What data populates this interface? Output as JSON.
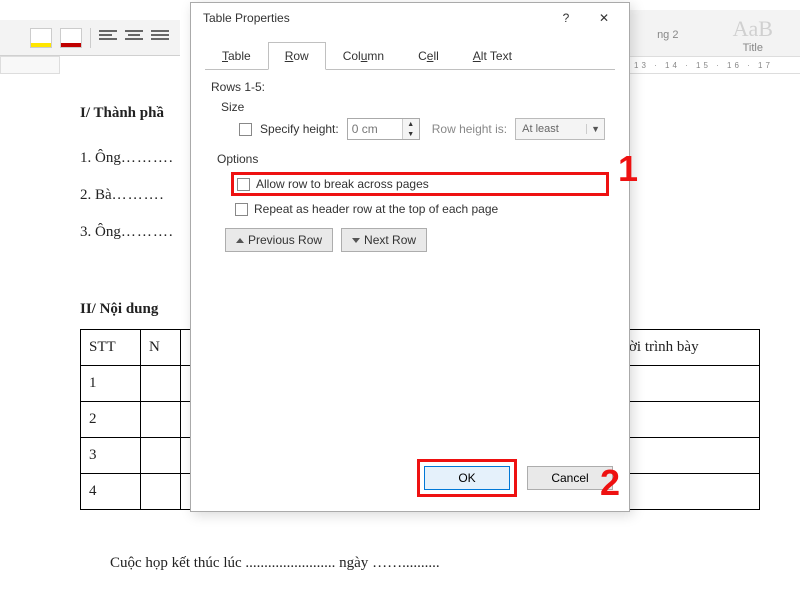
{
  "ribbon": {
    "style1": "ng 2",
    "style2": "Title",
    "ruler_right": "13 · 14 · 15 · 16 · 17"
  },
  "document": {
    "heading1": "I/ Thành phầ",
    "line1_prefix": "1. Ông",
    "line2_prefix": "2. Bà",
    "line3_prefix": "3. Ông",
    "dots_short": "……….",
    "heading2": "II/ Nội dung",
    "table": {
      "headers": {
        "c1": "STT",
        "c2": "N",
        "c_last": "ời trình bày"
      },
      "rows": [
        "1",
        "2",
        "3",
        "4"
      ]
    },
    "footer_prefix": "Cuộc họp kết thúc lúc",
    "footer_dots1": " ........................ ",
    "footer_mid": "ngày",
    "footer_dots2": " …….........."
  },
  "dialog": {
    "title": "Table Properties",
    "tabs": {
      "table": {
        "u": "T",
        "rest": "able"
      },
      "row": {
        "u": "R",
        "rest": "ow"
      },
      "column": {
        "pre": "Col",
        "u": "u",
        "rest": "mn"
      },
      "cell": {
        "pre": "C",
        "u": "e",
        "rest": "ll"
      },
      "alttext": {
        "u": "A",
        "rest": "lt Text"
      }
    },
    "rows_range": "Rows 1-5:",
    "size_label": "Size",
    "specify_height": {
      "pre": "",
      "u": "S",
      "rest": "pecify height:"
    },
    "height_value": "0 cm",
    "row_height_is": "Row height i",
    "row_height_is_u": "s",
    "row_height_is_colon": ":",
    "height_rule": "At least",
    "options_label": "Options",
    "allow_break": {
      "pre": "Allow row to brea",
      "u": "k",
      "rest": " across pages"
    },
    "repeat_header": {
      "pre": "Repeat as ",
      "u": "h",
      "rest": "eader row at the top of each page"
    },
    "prev_row": {
      "u": "P",
      "rest": "revious Row"
    },
    "next_row": {
      "u": "N",
      "rest": "ext Row"
    },
    "ok": "OK",
    "cancel": "Cancel",
    "help_icon": "?",
    "close_icon": "✕"
  },
  "markers": {
    "one": "1",
    "two": "2"
  }
}
